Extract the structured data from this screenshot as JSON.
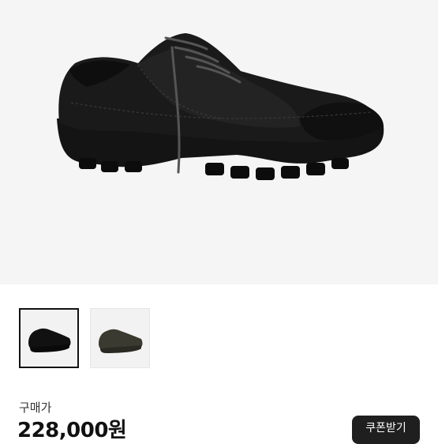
{
  "product": {
    "image_alt": "black-sneaker",
    "thumbnails": [
      {
        "name": "black-sneaker",
        "color": "#111111",
        "selected": true
      },
      {
        "name": "olive-sneaker",
        "color": "#3a3a30",
        "selected": false
      }
    ]
  },
  "pricing": {
    "label": "구매가",
    "price": "228,000원"
  },
  "actions": {
    "coupon_label": "쿠폰받기"
  },
  "colors": {
    "hero_bg": "#f5f5f5",
    "button_bg": "#1f1f1f",
    "text_primary": "#111111"
  }
}
